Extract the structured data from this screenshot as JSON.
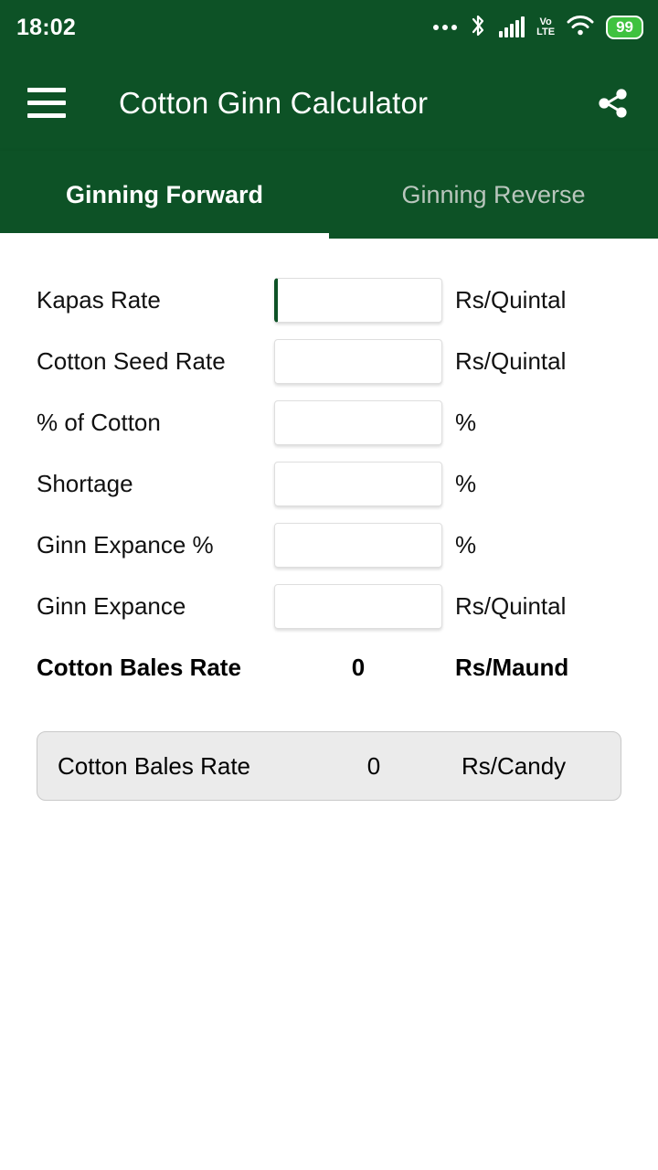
{
  "status_bar": {
    "time": "18:02",
    "icons": [
      "more-dots-icon",
      "bluetooth-icon",
      "signal-bars-icon",
      "volte-icon",
      "wifi-icon",
      "battery-icon"
    ],
    "volte_top": "Vo",
    "volte_bottom": "LTE",
    "battery_level": "99",
    "colors": {
      "background": "#0d5226",
      "battery_fill": "#3fc23f"
    }
  },
  "app_bar": {
    "menu_icon": "hamburger-menu-icon",
    "title": "Cotton Ginn Calculator",
    "share_icon": "share-icon",
    "color": "#0d5226"
  },
  "tabs": [
    {
      "label": "Ginning Forward",
      "active": true
    },
    {
      "label": "Ginning Reverse",
      "active": false
    }
  ],
  "form": {
    "rows": [
      {
        "label": "Kapas Rate",
        "value": "",
        "placeholder": "",
        "unit": "Rs/Quintal",
        "focused": true
      },
      {
        "label": "Cotton Seed Rate",
        "value": "",
        "placeholder": "",
        "unit": "Rs/Quintal",
        "focused": false
      },
      {
        "label": "% of Cotton",
        "value": "",
        "placeholder": "",
        "unit": "%",
        "focused": false
      },
      {
        "label": "Shortage",
        "value": "",
        "placeholder": "",
        "unit": "%",
        "focused": false
      },
      {
        "label": "Ginn Expance %",
        "value": "",
        "placeholder": "",
        "unit": "%",
        "focused": false
      },
      {
        "label": "Ginn Expance",
        "value": "",
        "placeholder": "",
        "unit": "Rs/Quintal",
        "focused": false
      }
    ]
  },
  "results": {
    "maund": {
      "label": "Cotton Bales Rate",
      "value": "0",
      "unit": "Rs/Maund"
    },
    "candy": {
      "label": "Cotton Bales Rate",
      "value": "0",
      "unit": "Rs/Candy"
    }
  }
}
